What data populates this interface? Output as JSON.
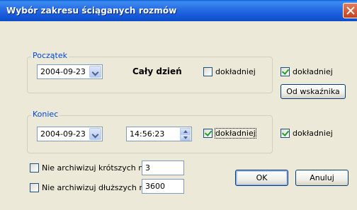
{
  "window": {
    "title": "Wybór zakresu ściąganych rozmów",
    "close_label": "×"
  },
  "start": {
    "group_label": "Początek",
    "date": "2004-09-23",
    "all_day_label": "Cały dzień",
    "detail_label": "dokładniej",
    "detail_checked": false,
    "side_detail_label": "dokładniej",
    "side_detail_checked": true,
    "from_pointer_button": "Od wskaźnika"
  },
  "end": {
    "group_label": "Koniec",
    "date": "2004-09-23",
    "time": "14:56:23",
    "detail_label": "dokładniej",
    "detail_checked": true,
    "side_detail_label": "dokładniej",
    "side_detail_checked": true
  },
  "filters": {
    "shorter_label": "Nie archiwizuj krótszych niż",
    "shorter_value": "3",
    "shorter_checked": false,
    "longer_label": "Nie archiwizuj dłuższych niż",
    "longer_value": "3600",
    "longer_checked": false
  },
  "buttons": {
    "ok": "OK",
    "cancel": "Anuluj"
  }
}
